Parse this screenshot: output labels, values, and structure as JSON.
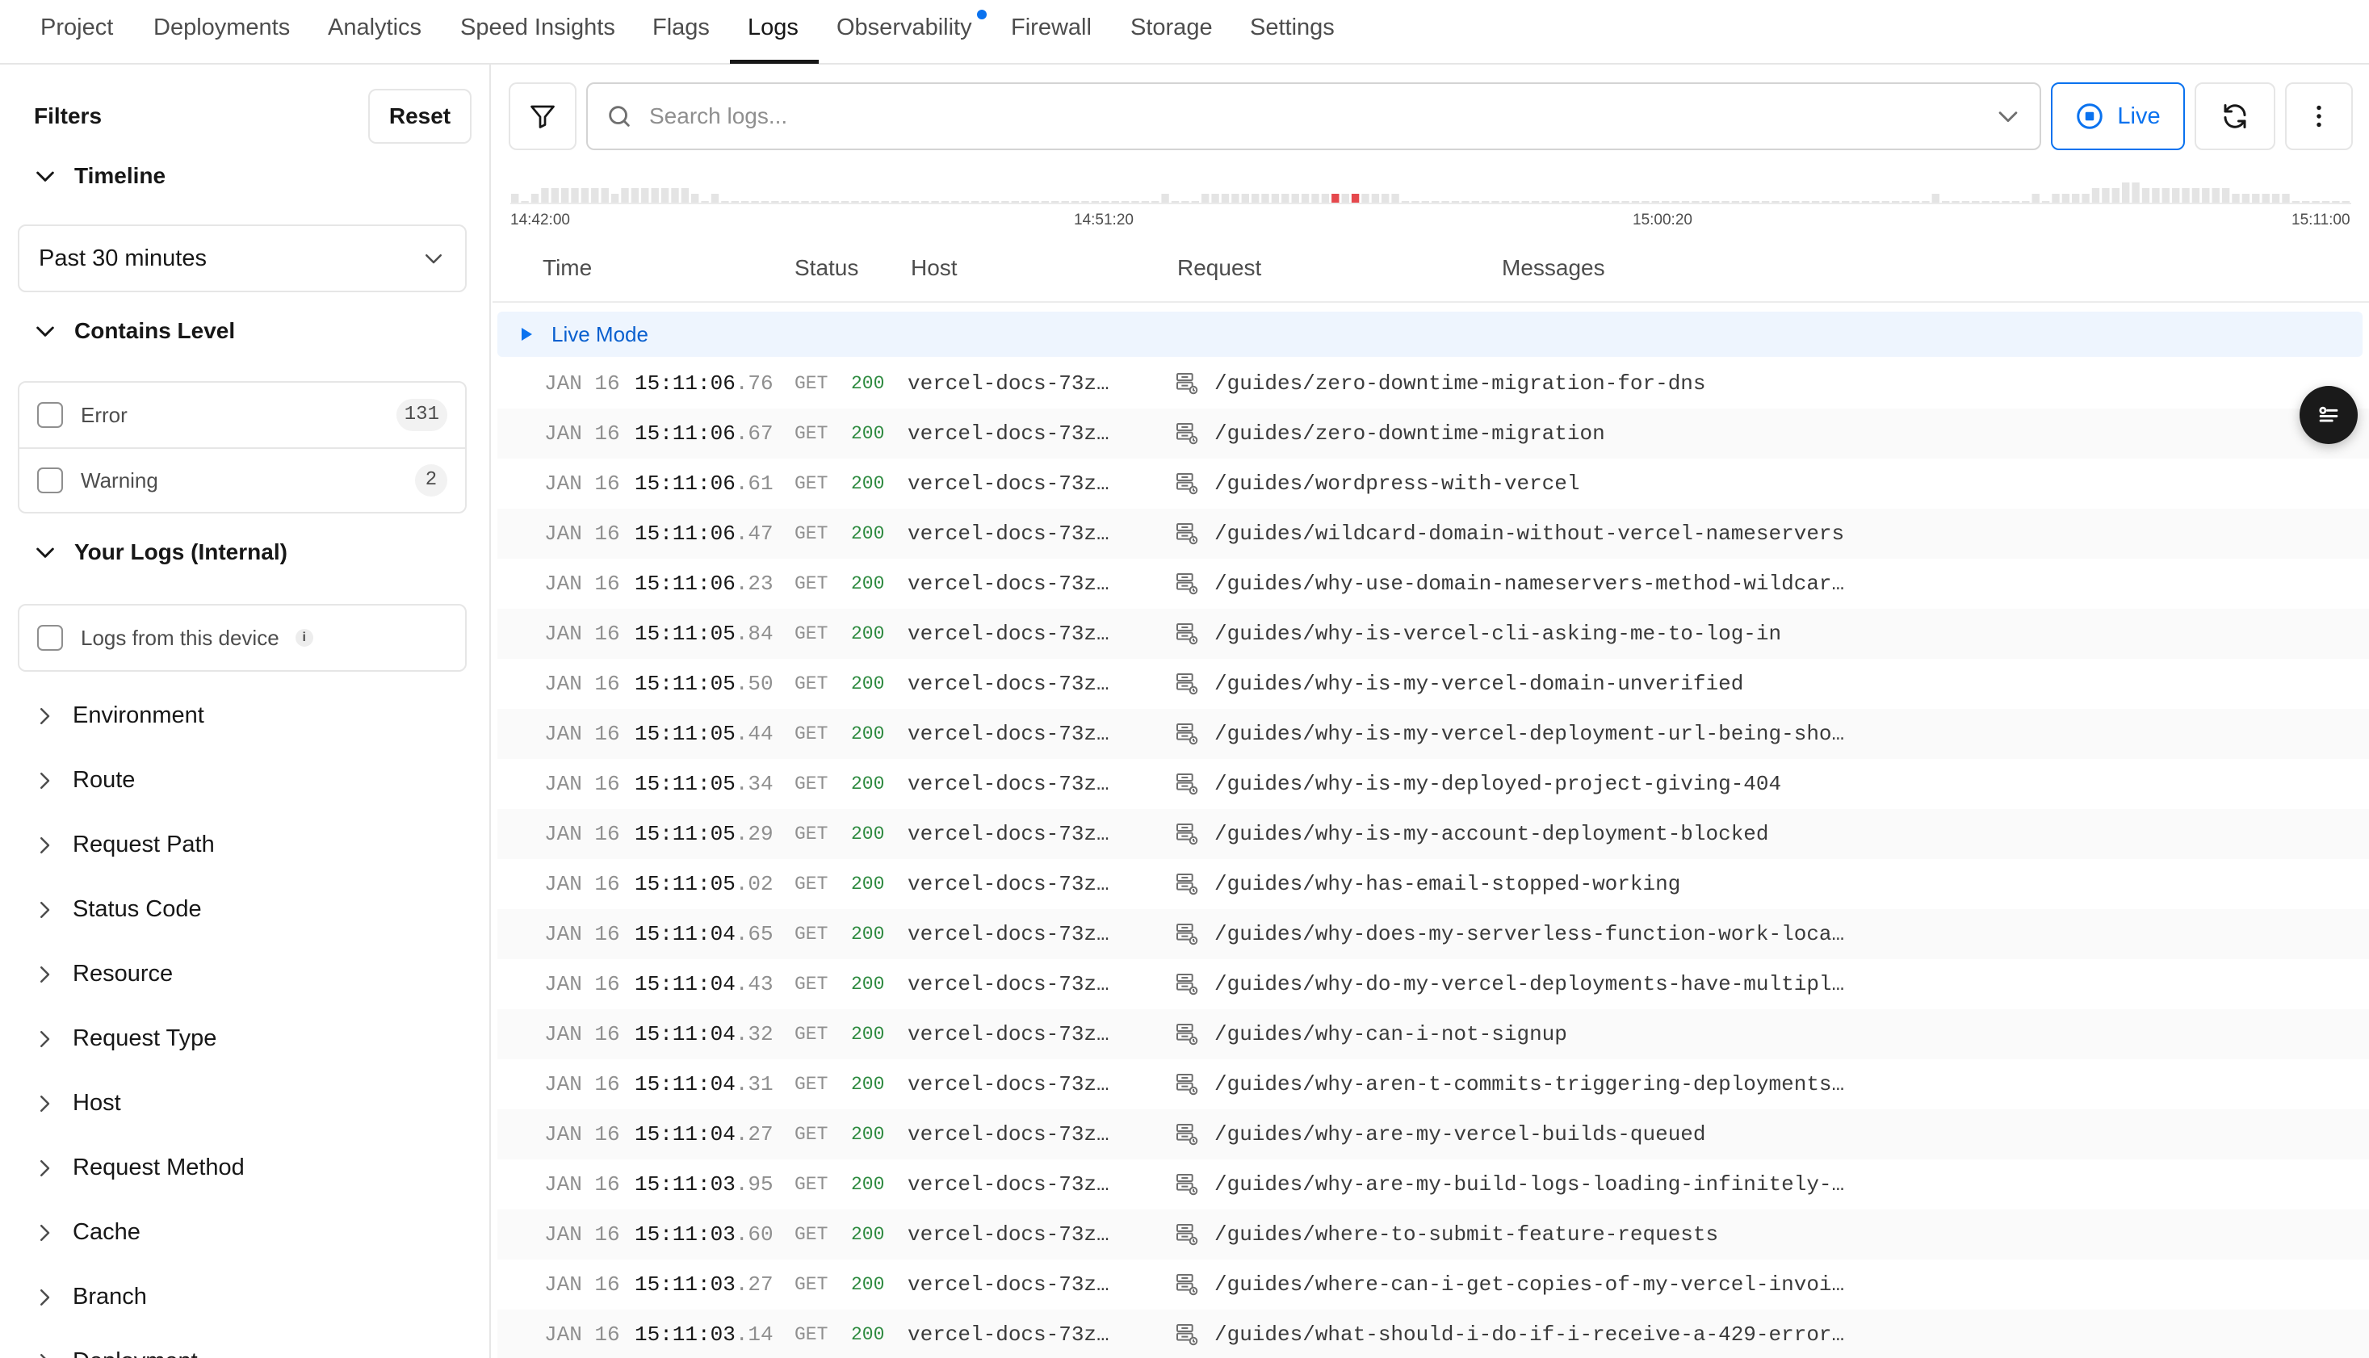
{
  "nav": {
    "tabs": [
      {
        "label": "Project"
      },
      {
        "label": "Deployments"
      },
      {
        "label": "Analytics"
      },
      {
        "label": "Speed Insights"
      },
      {
        "label": "Flags"
      },
      {
        "label": "Logs",
        "active": true
      },
      {
        "label": "Observability",
        "has_dot": true
      },
      {
        "label": "Firewall"
      },
      {
        "label": "Storage"
      },
      {
        "label": "Settings"
      }
    ]
  },
  "sidebar": {
    "title": "Filters",
    "reset_label": "Reset",
    "timeline": {
      "label": "Timeline",
      "selected": "Past 30 minutes"
    },
    "contains_level": {
      "label": "Contains Level",
      "options": [
        {
          "label": "Error",
          "count": "131"
        },
        {
          "label": "Warning",
          "count": "2"
        }
      ]
    },
    "your_logs": {
      "label": "Your Logs (Internal)",
      "option": "Logs from this device",
      "info_glyph": "i"
    },
    "collapsed_sections": [
      "Environment",
      "Route",
      "Request Path",
      "Status Code",
      "Resource",
      "Request Type",
      "Host",
      "Request Method",
      "Cache",
      "Branch",
      "Deployment"
    ]
  },
  "toolbar": {
    "search_placeholder": "Search logs...",
    "live_label": "Live"
  },
  "timeline_axis": {
    "ticks": [
      "14:42:00",
      "14:51:20",
      "15:00:20",
      "15:11:00"
    ],
    "bar_levels": [
      1,
      0,
      1,
      2,
      2,
      2,
      2,
      2,
      2,
      2,
      1,
      2,
      2,
      2,
      2,
      2,
      2,
      2,
      1,
      0,
      1,
      0,
      0,
      0,
      0,
      0,
      0,
      0,
      0,
      0,
      0,
      0,
      0,
      0,
      0,
      0,
      0,
      0,
      0,
      0,
      0,
      0,
      0,
      0,
      0,
      0,
      0,
      0,
      0,
      0,
      0,
      0,
      0,
      0,
      0,
      0,
      0,
      0,
      0,
      0,
      0,
      0,
      0,
      0,
      0,
      1,
      0,
      0,
      0,
      1,
      1,
      1,
      1,
      1,
      1,
      1,
      1,
      1,
      1,
      1,
      1,
      1,
      1,
      1,
      1,
      1,
      1,
      1,
      1,
      0,
      0,
      0,
      0,
      0,
      0,
      0,
      0,
      0,
      0,
      0,
      0,
      0,
      0,
      0,
      0,
      0,
      0,
      0,
      0,
      0,
      0,
      0,
      0,
      0,
      0,
      0,
      0,
      0,
      0,
      0,
      0,
      0,
      0,
      0,
      0,
      0,
      0,
      0,
      0,
      0,
      0,
      0,
      0,
      0,
      0,
      0,
      0,
      0,
      0,
      0,
      0,
      0,
      1,
      0,
      0,
      0,
      0,
      0,
      0,
      0,
      0,
      0,
      1,
      0,
      1,
      1,
      1,
      1,
      2,
      2,
      2,
      3,
      3,
      2,
      2,
      2,
      2,
      2,
      2,
      2,
      2,
      2,
      1,
      1,
      1,
      1,
      1,
      1,
      0,
      0,
      0,
      0,
      0,
      0
    ],
    "error_bars": [
      82,
      84
    ]
  },
  "table": {
    "columns": [
      "Time",
      "Status",
      "Host",
      "Request",
      "Messages"
    ],
    "live_mode_label": "Live Mode",
    "rows": [
      {
        "date": "JAN 16",
        "time": "15:11:06",
        "ms": ".76",
        "method": "GET",
        "status": "200",
        "host": "vercel-docs-73z…",
        "path": "/guides/zero-downtime-migration-for-dns"
      },
      {
        "date": "JAN 16",
        "time": "15:11:06",
        "ms": ".67",
        "method": "GET",
        "status": "200",
        "host": "vercel-docs-73z…",
        "path": "/guides/zero-downtime-migration"
      },
      {
        "date": "JAN 16",
        "time": "15:11:06",
        "ms": ".61",
        "method": "GET",
        "status": "200",
        "host": "vercel-docs-73z…",
        "path": "/guides/wordpress-with-vercel"
      },
      {
        "date": "JAN 16",
        "time": "15:11:06",
        "ms": ".47",
        "method": "GET",
        "status": "200",
        "host": "vercel-docs-73z…",
        "path": "/guides/wildcard-domain-without-vercel-nameservers"
      },
      {
        "date": "JAN 16",
        "time": "15:11:06",
        "ms": ".23",
        "method": "GET",
        "status": "200",
        "host": "vercel-docs-73z…",
        "path": "/guides/why-use-domain-nameservers-method-wildcar…"
      },
      {
        "date": "JAN 16",
        "time": "15:11:05",
        "ms": ".84",
        "method": "GET",
        "status": "200",
        "host": "vercel-docs-73z…",
        "path": "/guides/why-is-vercel-cli-asking-me-to-log-in"
      },
      {
        "date": "JAN 16",
        "time": "15:11:05",
        "ms": ".50",
        "method": "GET",
        "status": "200",
        "host": "vercel-docs-73z…",
        "path": "/guides/why-is-my-vercel-domain-unverified"
      },
      {
        "date": "JAN 16",
        "time": "15:11:05",
        "ms": ".44",
        "method": "GET",
        "status": "200",
        "host": "vercel-docs-73z…",
        "path": "/guides/why-is-my-vercel-deployment-url-being-sho…"
      },
      {
        "date": "JAN 16",
        "time": "15:11:05",
        "ms": ".34",
        "method": "GET",
        "status": "200",
        "host": "vercel-docs-73z…",
        "path": "/guides/why-is-my-deployed-project-giving-404"
      },
      {
        "date": "JAN 16",
        "time": "15:11:05",
        "ms": ".29",
        "method": "GET",
        "status": "200",
        "host": "vercel-docs-73z…",
        "path": "/guides/why-is-my-account-deployment-blocked"
      },
      {
        "date": "JAN 16",
        "time": "15:11:05",
        "ms": ".02",
        "method": "GET",
        "status": "200",
        "host": "vercel-docs-73z…",
        "path": "/guides/why-has-email-stopped-working"
      },
      {
        "date": "JAN 16",
        "time": "15:11:04",
        "ms": ".65",
        "method": "GET",
        "status": "200",
        "host": "vercel-docs-73z…",
        "path": "/guides/why-does-my-serverless-function-work-loca…"
      },
      {
        "date": "JAN 16",
        "time": "15:11:04",
        "ms": ".43",
        "method": "GET",
        "status": "200",
        "host": "vercel-docs-73z…",
        "path": "/guides/why-do-my-vercel-deployments-have-multipl…"
      },
      {
        "date": "JAN 16",
        "time": "15:11:04",
        "ms": ".32",
        "method": "GET",
        "status": "200",
        "host": "vercel-docs-73z…",
        "path": "/guides/why-can-i-not-signup"
      },
      {
        "date": "JAN 16",
        "time": "15:11:04",
        "ms": ".31",
        "method": "GET",
        "status": "200",
        "host": "vercel-docs-73z…",
        "path": "/guides/why-aren-t-commits-triggering-deployments…"
      },
      {
        "date": "JAN 16",
        "time": "15:11:04",
        "ms": ".27",
        "method": "GET",
        "status": "200",
        "host": "vercel-docs-73z…",
        "path": "/guides/why-are-my-vercel-builds-queued"
      },
      {
        "date": "JAN 16",
        "time": "15:11:03",
        "ms": ".95",
        "method": "GET",
        "status": "200",
        "host": "vercel-docs-73z…",
        "path": "/guides/why-are-my-build-logs-loading-infinitely-…"
      },
      {
        "date": "JAN 16",
        "time": "15:11:03",
        "ms": ".60",
        "method": "GET",
        "status": "200",
        "host": "vercel-docs-73z…",
        "path": "/guides/where-to-submit-feature-requests"
      },
      {
        "date": "JAN 16",
        "time": "15:11:03",
        "ms": ".27",
        "method": "GET",
        "status": "200",
        "host": "vercel-docs-73z…",
        "path": "/guides/where-can-i-get-copies-of-my-vercel-invoi…"
      },
      {
        "date": "JAN 16",
        "time": "15:11:03",
        "ms": ".14",
        "method": "GET",
        "status": "200",
        "host": "vercel-docs-73z…",
        "path": "/guides/what-should-i-do-if-i-receive-a-429-error…"
      }
    ]
  },
  "colors": {
    "accent": "#0a72ef",
    "status_ok": "#2d8a3f",
    "error_bar": "#e5484d"
  }
}
